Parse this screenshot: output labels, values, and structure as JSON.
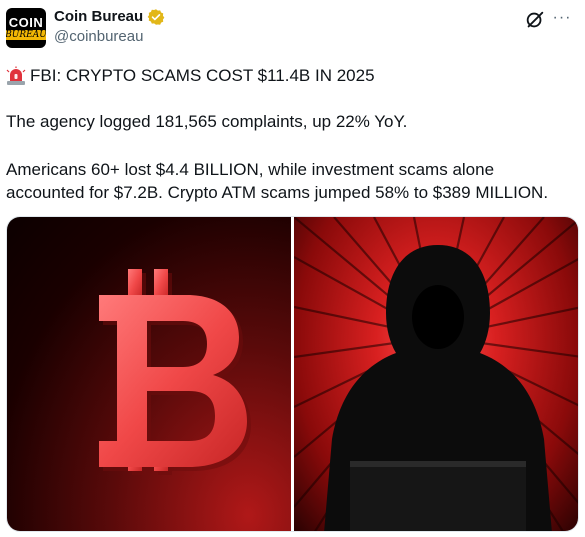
{
  "author": {
    "display_name": "Coin Bureau",
    "handle": "@coinbureau",
    "avatar_line1": "COIN",
    "avatar_line2": "BUREAU",
    "verified_color": "#e2b719"
  },
  "tweet": {
    "headline": "FBI: CRYPTO SCAMS COST $11.4B IN 2025",
    "paragraph1": "The agency logged 181,565 complaints, up 22% YoY.",
    "paragraph2_line1": "Americans 60+ lost $4.4 BILLION, while investment scams alone",
    "paragraph2_line2": "accounted for $7.2B. Crypto ATM scams jumped 58% to $389 MILLION.",
    "leading_icon": "police-siren-icon"
  },
  "actions": {
    "grok_icon": "grok-icon",
    "more_icon": "more-options-icon",
    "more_label": "···"
  },
  "media": [
    {
      "name": "bitcoin-symbol-image",
      "icon": "bitcoin-icon"
    },
    {
      "name": "hooded-hacker-image",
      "icon": "hacker-icon"
    }
  ],
  "colors": {
    "text": "#0f1419",
    "secondary": "#536471",
    "accent_red": "#e03030"
  }
}
